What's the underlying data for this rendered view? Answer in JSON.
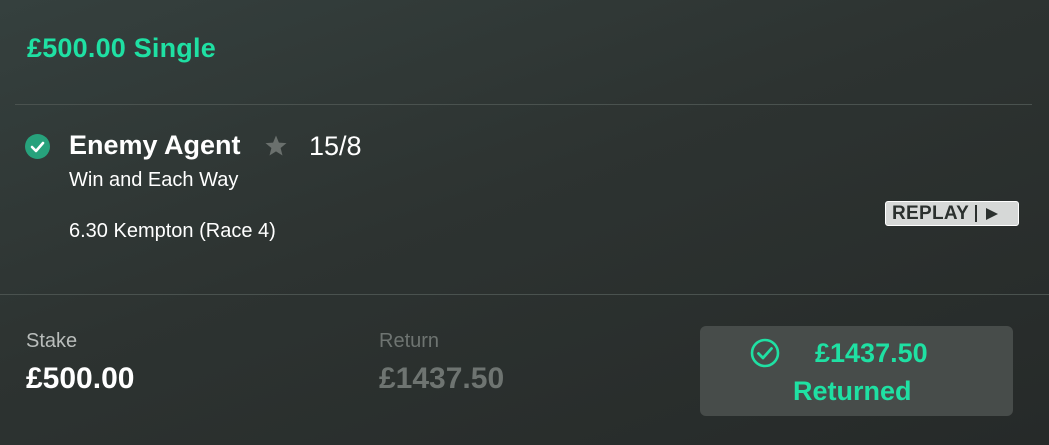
{
  "bet": {
    "title": "£500.00 Single"
  },
  "selection": {
    "runner": "Enemy Agent",
    "odds": "15/8",
    "bet_type": "Win and Each Way",
    "race": "6.30 Kempton (Race 4)",
    "status": "won"
  },
  "replay": {
    "label": "REPLAY",
    "icon": "play-icon"
  },
  "summary": {
    "stake_label": "Stake",
    "stake_value": "£500.00",
    "return_label": "Return",
    "return_value": "£1437.50"
  },
  "returned": {
    "amount": "£1437.50",
    "label": "Returned"
  },
  "colors": {
    "accent": "#1fe0a3",
    "check_fill": "#27a27c",
    "muted": "#6e7471"
  }
}
